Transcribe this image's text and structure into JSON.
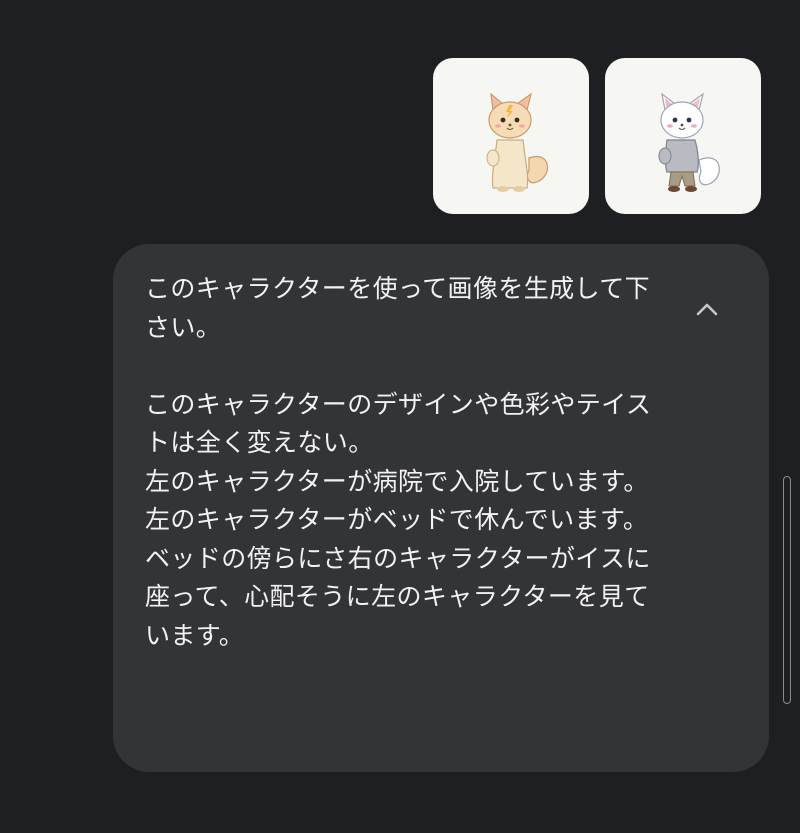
{
  "attachments": [
    {
      "icon": "cream-cat-character-image",
      "name": "left-character"
    },
    {
      "icon": "white-cat-hoodie-character-image",
      "name": "right-character"
    }
  ],
  "message": {
    "text": "このキャラクターを使って画像を生成して下さい。\n\nこのキャラクターのデザインや色彩やテイストは全く変えない。\n左のキャラクターが病院で入院しています。\n左のキャラクターがベッドで休んでいます。\nベッドの傍らにさ右のキャラクターがイスに座って、心配そうに左のキャラクターを見ています。"
  },
  "controls": {
    "collapse_icon": "chevron-up-icon"
  },
  "colors": {
    "background": "#1e1f22",
    "bubble": "#333437",
    "text": "#f2f2f2"
  }
}
